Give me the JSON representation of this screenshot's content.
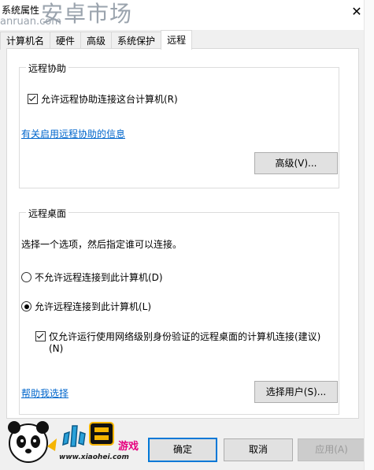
{
  "window": {
    "title": "系统属性",
    "close_glyph": "✕"
  },
  "watermark": {
    "text": "安卓市场",
    "url": "anruan.com"
  },
  "tabs": [
    {
      "label": "计算机名"
    },
    {
      "label": "硬件"
    },
    {
      "label": "高级"
    },
    {
      "label": "系统保护"
    },
    {
      "label": "远程",
      "active": true
    }
  ],
  "remote_assistance": {
    "title": "远程协助",
    "allow_label": "允许远程协助连接这台计算机(R)",
    "allow_checked": true,
    "info_link": "有关启用远程协助的信息",
    "advanced_button": "高级(V)..."
  },
  "remote_desktop": {
    "title": "远程桌面",
    "instruction": "选择一个选项，然后指定谁可以连接。",
    "option_deny": "不允许远程连接到此计算机(D)",
    "option_allow": "允许远程连接到此计算机(L)",
    "selected": "allow",
    "nla_label_line1": "仅允许运行使用网络级别身份验证的远程桌面的计算机连接(建议)",
    "nla_label_line2": "(N)",
    "nla_checked": true,
    "help_link": "帮助我选择",
    "select_users_button": "选择用户(S)..."
  },
  "footer": {
    "ok_button": "确定",
    "cancel_button": "取消",
    "apply_button": "应用(A)"
  },
  "logo": {
    "url": "www.xiaohei.com",
    "game_text": "游戏"
  },
  "colors": {
    "link": "#0066cc",
    "primary_border": "#0078d7",
    "watermark": "#9aa3ad",
    "logo_accent": "#e6007e"
  }
}
